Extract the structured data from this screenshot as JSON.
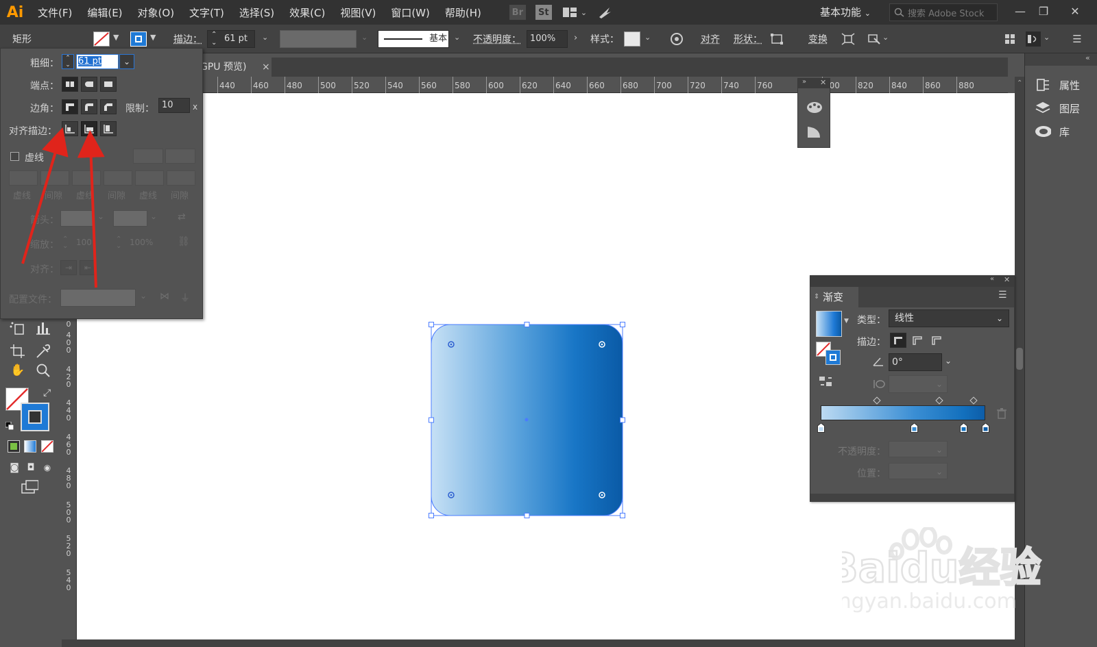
{
  "app": {
    "logo": "Ai",
    "workspace": "基本功能",
    "search_placeholder": "搜索 Adobe Stock"
  },
  "menu": [
    "文件(F)",
    "编辑(E)",
    "对象(O)",
    "文字(T)",
    "选择(S)",
    "效果(C)",
    "视图(V)",
    "窗口(W)",
    "帮助(H)"
  ],
  "menubar_icons": {
    "br": "Br",
    "st": "St"
  },
  "control_bar": {
    "object_type": "矩形",
    "stroke_label": "描边：",
    "stroke_value": "61 pt",
    "stroke_profile": "基本",
    "opacity_label": "不透明度：",
    "opacity_value": "100%",
    "style_label": "样式：",
    "align_label": "对齐",
    "shape_label": "形状：",
    "transform_label": "变换"
  },
  "stroke_panel": {
    "weight_label": "粗细：",
    "weight_value": "61 pt",
    "cap_label": "端点：",
    "corner_label": "边角：",
    "limit_label": "限制：",
    "limit_value": "10",
    "limit_unit": "x",
    "align_label": "对齐描边：",
    "dashed_label": "虚线",
    "dash_labels": [
      "虚线",
      "间隙",
      "虚线",
      "间隙",
      "虚线",
      "间隙"
    ],
    "arrow_label": "箭头：",
    "scale_label": "缩放：",
    "scale_value_1": "100",
    "scale_value_2": "100%",
    "align_arrow_label": "对齐：",
    "profile_label": "配置文件："
  },
  "document": {
    "tab_label": "GPU 预览)",
    "tab_close": "×"
  },
  "ruler": {
    "h_ticks": [
      "440",
      "460",
      "480",
      "500",
      "520",
      "540",
      "560",
      "580",
      "600",
      "620",
      "640",
      "660",
      "680",
      "700",
      "720",
      "740",
      "760",
      "800",
      "820",
      "840",
      "860",
      "880"
    ],
    "v_ticks": [
      "0",
      "4\n0\n0",
      "4\n2\n0",
      "4\n4\n0",
      "4\n6\n0",
      "4\n8\n0",
      "5\n0\n0",
      "5\n2\n0",
      "5\n4\n0"
    ]
  },
  "gradient_panel": {
    "tab_label": "渐变",
    "type_label": "类型：",
    "type_value": "线性",
    "stroke_label": "描边：",
    "angle_value": "0°",
    "opacity_label": "不透明度：",
    "position_label": "位置：",
    "stops": [
      {
        "position": 0.0,
        "color": "#bcdaf2"
      },
      {
        "position": 0.57,
        "color": "#3a8ed4"
      },
      {
        "position": 0.87,
        "color": "#1370bd"
      },
      {
        "position": 1.0,
        "color": "#0d5da8"
      }
    ],
    "midpoints": [
      0.34,
      0.72,
      0.93
    ]
  },
  "right_dock": {
    "items": [
      "属性",
      "图层",
      "库"
    ]
  },
  "watermark": {
    "brand": "Baidu经验",
    "url": "jingyan.baidu.com"
  },
  "colors": {
    "accent": "#1f6fd0",
    "arrow": "#e0241b",
    "gradient_start": "#c6e0f5",
    "gradient_end": "#0a5aa6",
    "selection": "#4a7cff"
  }
}
